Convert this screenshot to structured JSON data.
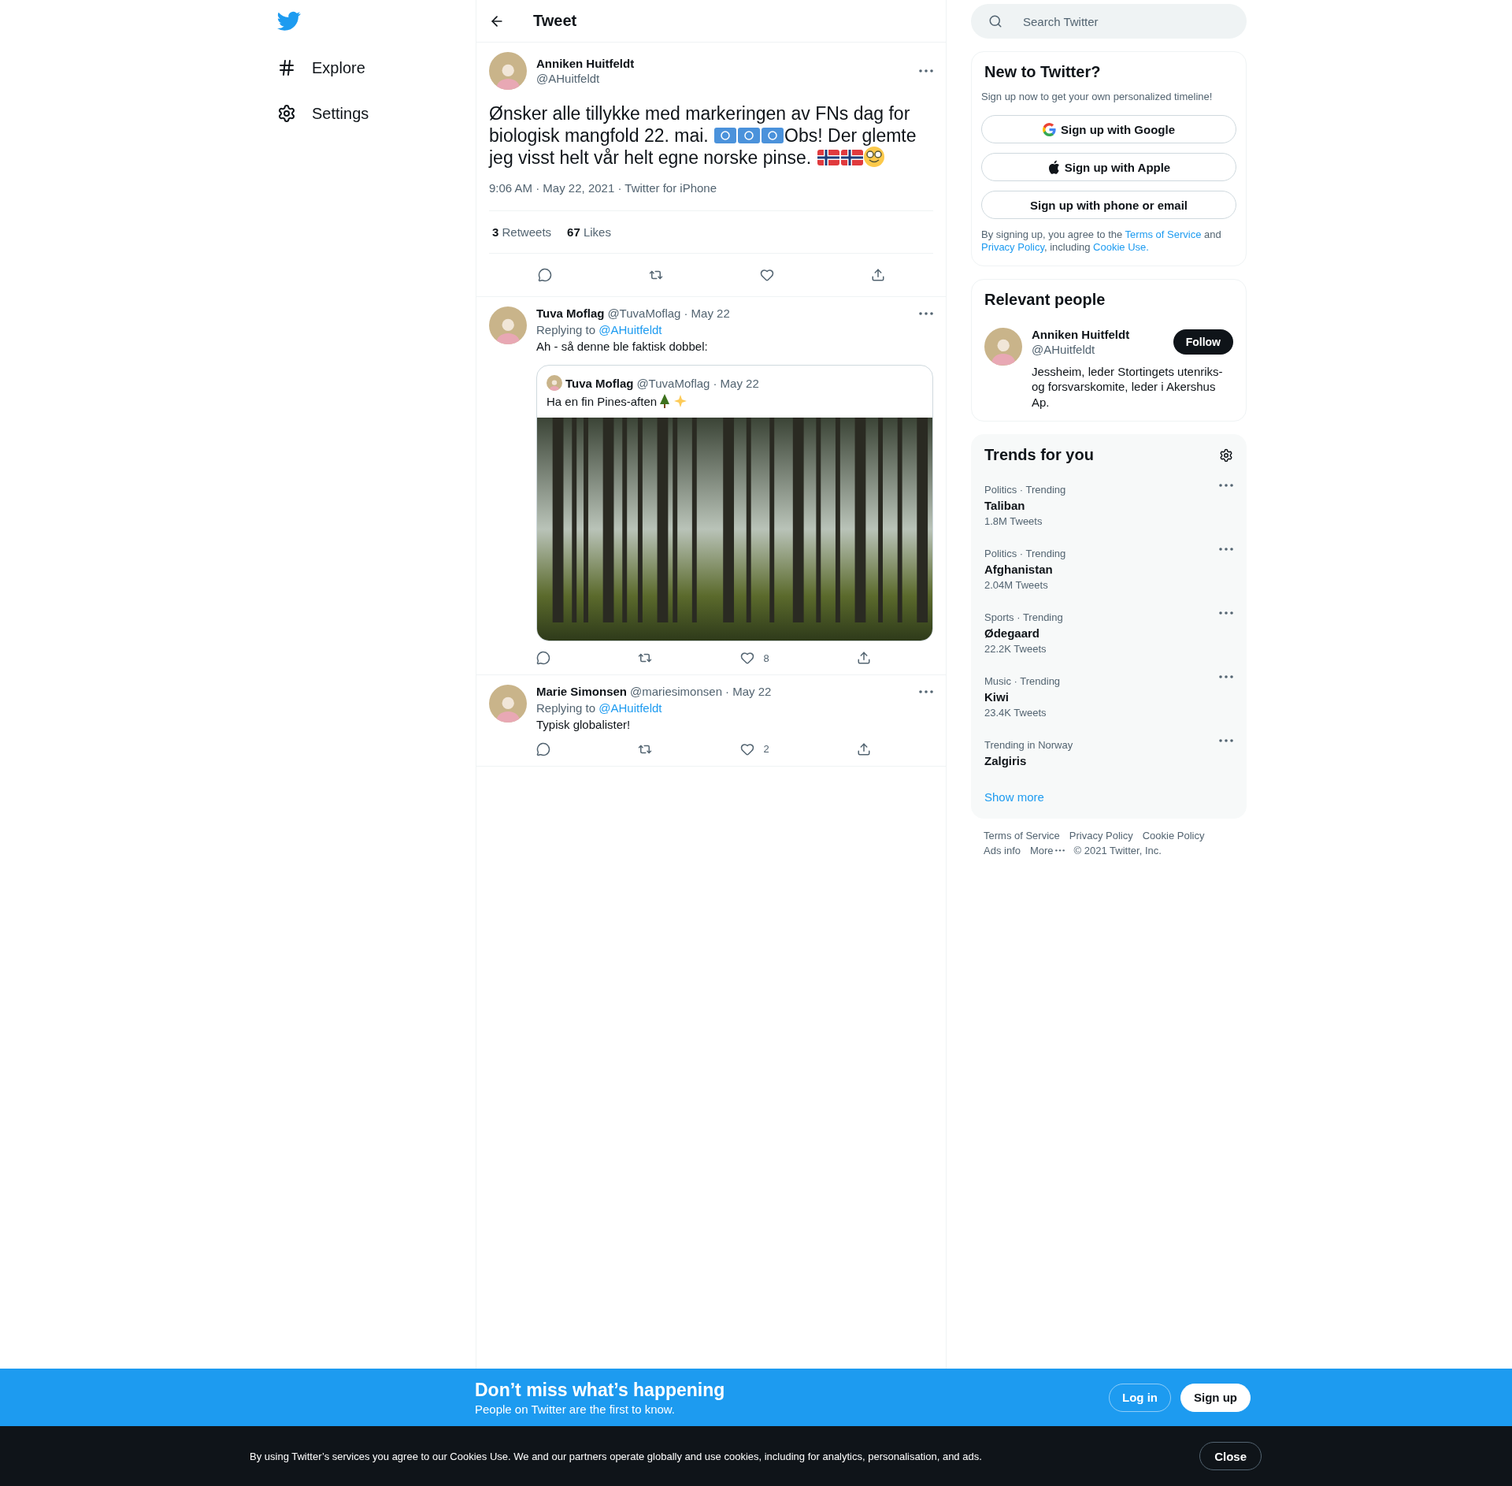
{
  "nav": {
    "items": [
      {
        "kind": "explore",
        "label": "Explore"
      },
      {
        "kind": "settings",
        "label": "Settings"
      }
    ]
  },
  "header": {
    "title": "Tweet"
  },
  "tweet": {
    "name": "Anniken Huitfeldt",
    "handle": "@AHuitfeldt",
    "body": [
      {
        "kind": "text",
        "text": "Ønsker alle tillykke med markeringen av FNs dag for biologisk mangfold 22. mai. "
      },
      {
        "kind": "un_flag"
      },
      {
        "kind": "un_flag"
      },
      {
        "kind": "un_flag"
      },
      {
        "kind": "text",
        "text": "Obs! Der glemte jeg visst helt vår helt egne norske pinse. "
      },
      {
        "kind": "norway_flag"
      },
      {
        "kind": "norway_flag"
      },
      {
        "kind": "nerd_face"
      }
    ],
    "meta": "9:06 AM · May 22, 2021 · Twitter for iPhone",
    "stats": [
      {
        "count": "3",
        "label": "Retweets"
      },
      {
        "count": "67",
        "label": "Likes"
      }
    ],
    "actions": [
      {
        "kind": "reply"
      },
      {
        "kind": "retweet"
      },
      {
        "kind": "like"
      },
      {
        "kind": "share"
      }
    ]
  },
  "replies": [
    {
      "name": "Tuva Moflag",
      "handle": "@TuvaMoflag",
      "date": "· May 22",
      "replying_label": "Replying to",
      "replying_handle": "@AHuitfeldt",
      "text": "Ah - så denne ble faktisk dobbel:",
      "quote": {
        "name": "Tuva Moflag",
        "handle": "@TuvaMoflag",
        "date": "· May 22",
        "body": [
          {
            "kind": "text",
            "text": "Ha en fin Pines-aften "
          },
          {
            "kind": "tree"
          },
          {
            "kind": "sparkles"
          }
        ]
      },
      "actions": [
        {
          "kind": "reply"
        },
        {
          "kind": "retweet"
        },
        {
          "kind": "like",
          "count": "8"
        },
        {
          "kind": "share"
        }
      ]
    },
    {
      "name": "Marie Simonsen",
      "handle": "@mariesimonsen",
      "date": "· May 22",
      "replying_label": "Replying to",
      "replying_handle": "@AHuitfeldt",
      "text": "Typisk globalister!",
      "actions": [
        {
          "kind": "reply"
        },
        {
          "kind": "retweet"
        },
        {
          "kind": "like",
          "count": "2"
        },
        {
          "kind": "share"
        }
      ]
    }
  ],
  "search": {
    "placeholder": "Search Twitter"
  },
  "signup": {
    "title": "New to Twitter?",
    "subtitle": "Sign up now to get your own personalized timeline!",
    "buttons": [
      {
        "kind": "google",
        "label": "Sign up with Google"
      },
      {
        "kind": "apple",
        "label": "Sign up with Apple"
      },
      {
        "kind": "plain",
        "label": "Sign up with phone or email"
      }
    ],
    "legal": [
      {
        "kind": "text",
        "text": "By signing up, you agree to the "
      },
      {
        "kind": "link",
        "text": "Terms of Service"
      },
      {
        "kind": "text",
        "text": " and "
      },
      {
        "kind": "link",
        "text": "Privacy Policy"
      },
      {
        "kind": "text",
        "text": ", including "
      },
      {
        "kind": "link",
        "text": "Cookie Use."
      }
    ]
  },
  "relevant": {
    "title": "Relevant people",
    "person": {
      "name": "Anniken Huitfeldt",
      "handle": "@AHuitfeldt",
      "bio": "Jessheim, leder Stortingets utenriks- og forsvarskomite, leder i Akershus Ap.",
      "button": "Follow"
    }
  },
  "trends": {
    "title": "Trends for you",
    "items": [
      {
        "context": "Politics · Trending",
        "topic": "Taliban",
        "count": "1.8M Tweets"
      },
      {
        "context": "Politics · Trending",
        "topic": "Afghanistan",
        "count": "2.04M Tweets"
      },
      {
        "context": "Sports · Trending",
        "topic": "Ødegaard",
        "count": "22.2K Tweets"
      },
      {
        "context": "Music · Trending",
        "topic": "Kiwi",
        "count": "23.4K Tweets"
      },
      {
        "context": "Trending in Norway",
        "topic": "Zalgiris"
      }
    ],
    "show_more": "Show more"
  },
  "footer": {
    "links": [
      {
        "kind": "link",
        "label": "Terms of Service"
      },
      {
        "kind": "link",
        "label": "Privacy Policy"
      },
      {
        "kind": "link",
        "label": "Cookie Policy"
      },
      {
        "kind": "link",
        "label": "Ads info"
      },
      {
        "kind": "more",
        "label": "More"
      }
    ],
    "copyright": "© 2021 Twitter, Inc."
  },
  "banner": {
    "title": "Don’t miss what’s happening",
    "subtitle": "People on Twitter are the first to know.",
    "login": "Log in",
    "signup": "Sign up"
  },
  "cookie_bar": {
    "text": "By using Twitter’s services you agree to our Cookies Use. We and our partners operate globally and use cookies, including for analytics, personalisation, and ads.",
    "button": "Close"
  }
}
